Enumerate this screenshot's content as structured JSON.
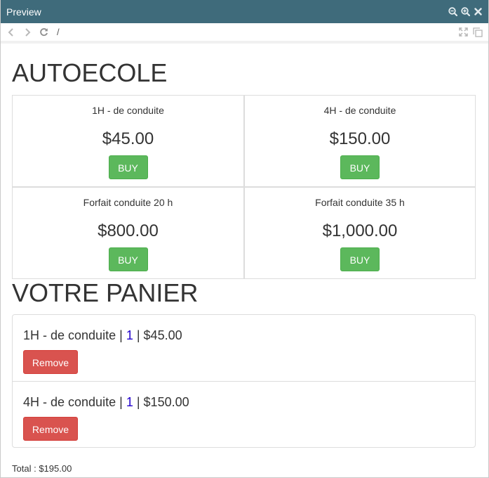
{
  "window": {
    "title": "Preview",
    "icons": [
      "zoom-out-icon",
      "zoom-in-icon",
      "close-icon"
    ]
  },
  "toolbar": {
    "url": "/",
    "icons": [
      "back-icon",
      "forward-icon",
      "refresh-icon",
      "expand-icon",
      "popout-icon"
    ]
  },
  "shop": {
    "title": "AUTOECOLE",
    "products": [
      {
        "name": "1H - de conduite",
        "price": "$45.00",
        "button": "BUY"
      },
      {
        "name": "4H - de conduite",
        "price": "$150.00",
        "button": "BUY"
      },
      {
        "name": "Forfait conduite 20 h",
        "price": "$800.00",
        "button": "BUY"
      },
      {
        "name": "Forfait conduite 35 h",
        "price": "$1,000.00",
        "button": "BUY"
      }
    ]
  },
  "cart": {
    "title": "VOTRE PANIER",
    "separator": "|",
    "items": [
      {
        "name": "1H - de conduite",
        "qty": "1",
        "price": "$45.00",
        "button": "Remove"
      },
      {
        "name": "4H - de conduite",
        "qty": "1",
        "price": "$150.00",
        "button": "Remove"
      }
    ],
    "total_label": "Total :",
    "total_value": "$195.00"
  },
  "colors": {
    "titlebar": "#3f6b7b",
    "buy": "#5cb85c",
    "remove": "#d9534f",
    "qty_link": "#2200cc"
  }
}
